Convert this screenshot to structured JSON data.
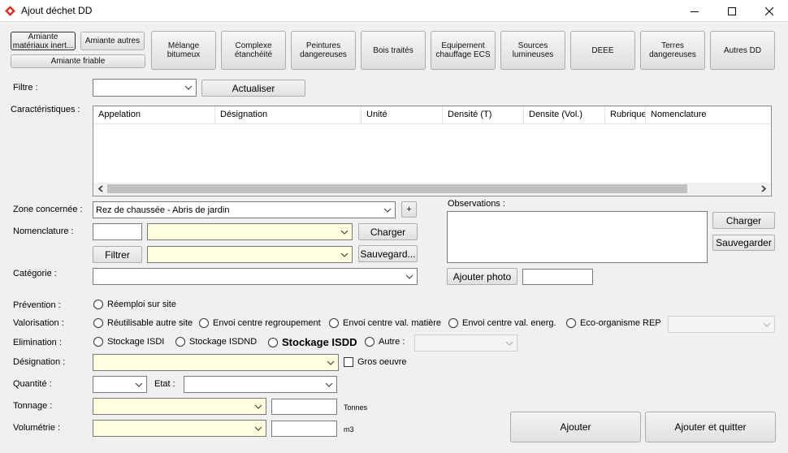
{
  "window": {
    "title": "Ajout déchet DD",
    "minimize_icon": "minimize-icon",
    "maximize_icon": "maximize-icon",
    "close_icon": "close-icon"
  },
  "tiles": {
    "amiante_inerte": "Amiante matériaux inert...",
    "amiante_autres": "Amiante autres",
    "amiante_friable": "Amiante friable",
    "melange": "Mélange bitumeux",
    "complexe": "Complexe étanchéité",
    "peintures": "Peintures dangereuses",
    "bois": "Bois traités",
    "equipement": "Equipement chauffage ECS",
    "sources": "Sources lumineuses",
    "deee": "DEEE",
    "terres": "Terres dangereuses",
    "autres": "Autres DD"
  },
  "filtre": {
    "label": "Filtre :",
    "value": "",
    "refresh": "Actualiser"
  },
  "caracteristiques": {
    "label": "Caractéristiques :",
    "columns": [
      "Appelation",
      "Désignation",
      "Unité",
      "Densité (T)",
      "Densite (Vol.)",
      "Rubrique",
      "Nomenclature"
    ]
  },
  "zone": {
    "label": "Zone concernée :",
    "value": "Rez de chaussée - Abris de jardin",
    "add": "+"
  },
  "nomenclature": {
    "label": "Nomenclature :",
    "code": "",
    "value": "",
    "load": "Charger",
    "filter": "Filtrer",
    "value2": "",
    "save": "Sauvegard..."
  },
  "categorie": {
    "label": "Catégorie :",
    "value": ""
  },
  "observations": {
    "label": "Observations :",
    "value": "",
    "load": "Charger",
    "save": "Sauvegarder",
    "add_photo": "Ajouter photo",
    "photo": ""
  },
  "prevention": {
    "label": "Prévention :",
    "options": [
      "Réemploi sur site"
    ]
  },
  "valorisation": {
    "label": "Valorisation :",
    "options": [
      "Réutilisable autre site",
      "Envoi centre regroupement",
      "Envoi centre val. matière",
      "Envoi centre val. energ.",
      "Eco-organisme REP"
    ],
    "rep_value": ""
  },
  "elimination": {
    "label": "Elimination :",
    "options": [
      "Stockage ISDI",
      "Stockage ISDND",
      "Stockage ISDD",
      "Autre :"
    ],
    "other_value": ""
  },
  "designation": {
    "label": "Désignation :",
    "value": "",
    "gros_oeuvre": "Gros oeuvre"
  },
  "quantite": {
    "label": "Quantité :",
    "value": "",
    "etat_label": "Etat :",
    "etat_value": ""
  },
  "tonnage": {
    "label": "Tonnage :",
    "value": "",
    "amount": "",
    "unit": "Tonnes"
  },
  "volumetrie": {
    "label": "Volumétrie :",
    "value": "",
    "amount": "",
    "unit": "m3"
  },
  "actions": {
    "add": "Ajouter",
    "add_quit": "Ajouter et quitter"
  }
}
